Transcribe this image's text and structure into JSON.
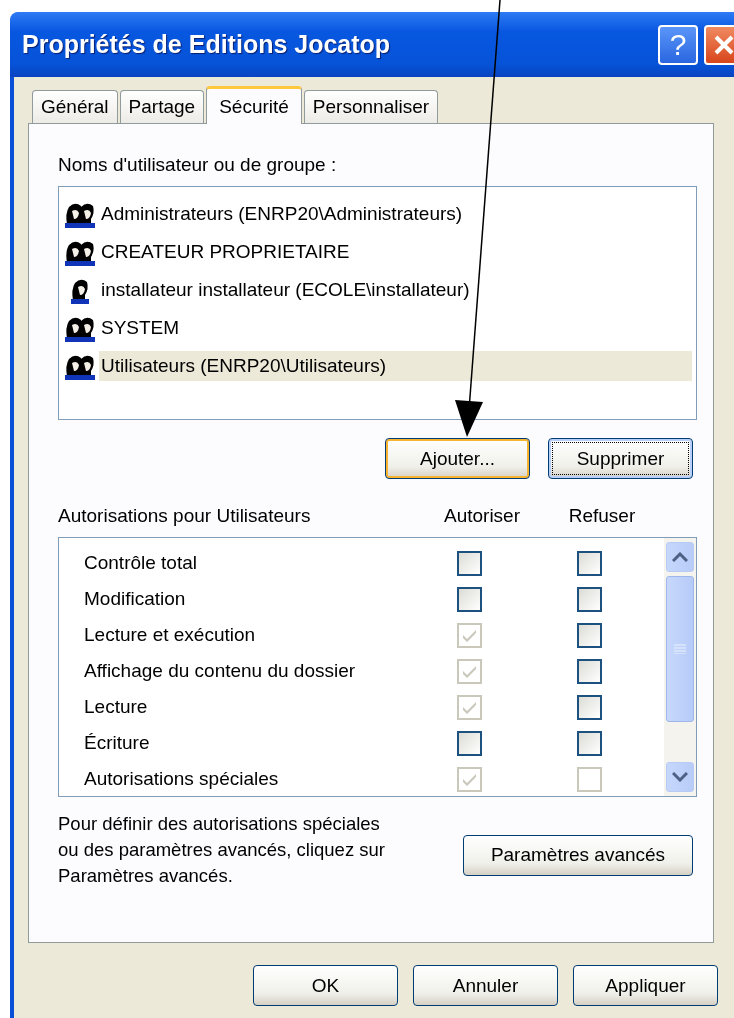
{
  "window": {
    "title": "Propriétés de Editions Jocatop",
    "help_button": "?"
  },
  "tabs": [
    {
      "label": "Général",
      "selected": false
    },
    {
      "label": "Partage",
      "selected": false
    },
    {
      "label": "Sécurité",
      "selected": true
    },
    {
      "label": "Personnaliser",
      "selected": false
    }
  ],
  "users": {
    "label": "Noms d'utilisateur ou de groupe :",
    "items": [
      {
        "name": "Administrateurs (ENRP20\\Administrateurs)",
        "kind": "group",
        "selected": false
      },
      {
        "name": "CREATEUR PROPRIETAIRE",
        "kind": "group",
        "selected": false
      },
      {
        "name": "installateur installateur (ECOLE\\installateur)",
        "kind": "user",
        "selected": false
      },
      {
        "name": "SYSTEM",
        "kind": "group",
        "selected": false
      },
      {
        "name": "Utilisateurs (ENRP20\\Utilisateurs)",
        "kind": "group",
        "selected": true
      }
    ],
    "buttons": [
      {
        "label": "Ajouter...",
        "hot": true,
        "focused": false
      },
      {
        "label": "Supprimer",
        "hot": false,
        "focused": true
      }
    ]
  },
  "permissions": {
    "label": "Autorisations pour Utilisateurs",
    "columns": [
      "Autoriser",
      "Refuser"
    ],
    "rows": [
      {
        "name": "Contrôle total",
        "allow": {
          "checked": false,
          "disabled": false
        },
        "deny": {
          "checked": false,
          "disabled": false
        }
      },
      {
        "name": "Modification",
        "allow": {
          "checked": false,
          "disabled": false
        },
        "deny": {
          "checked": false,
          "disabled": false
        }
      },
      {
        "name": "Lecture et exécution",
        "allow": {
          "checked": true,
          "disabled": true
        },
        "deny": {
          "checked": false,
          "disabled": false
        }
      },
      {
        "name": "Affichage du contenu du dossier",
        "allow": {
          "checked": true,
          "disabled": true
        },
        "deny": {
          "checked": false,
          "disabled": false
        }
      },
      {
        "name": "Lecture",
        "allow": {
          "checked": true,
          "disabled": true
        },
        "deny": {
          "checked": false,
          "disabled": false
        }
      },
      {
        "name": "Écriture",
        "allow": {
          "checked": false,
          "disabled": false
        },
        "deny": {
          "checked": false,
          "disabled": false
        }
      },
      {
        "name": "Autorisations spéciales",
        "allow": {
          "checked": true,
          "disabled": true
        },
        "deny": {
          "checked": false,
          "disabled": true
        }
      }
    ]
  },
  "advanced": {
    "text": "Pour définir des autorisations spéciales ou des paramètres avancés, cliquez sur Paramètres avancés.",
    "button": "Paramètres avancés"
  },
  "footer_buttons": [
    {
      "label": "OK"
    },
    {
      "label": "Annuler"
    },
    {
      "label": "Appliquer"
    }
  ]
}
